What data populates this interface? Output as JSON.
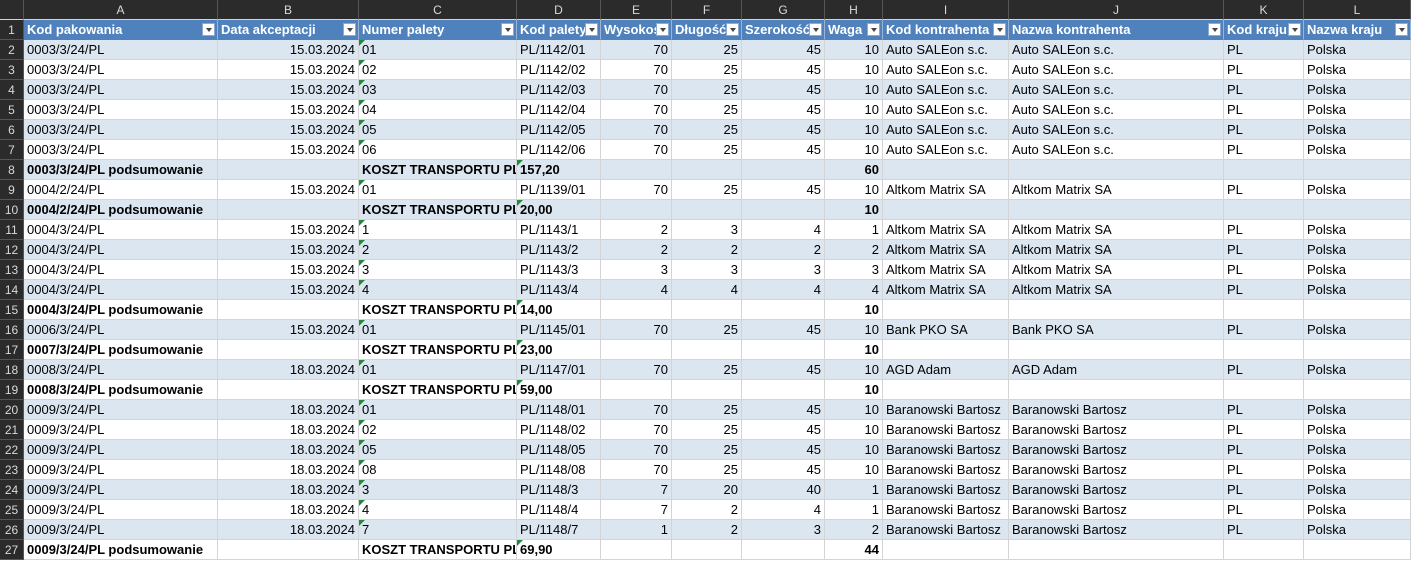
{
  "col_letters": [
    "A",
    "B",
    "C",
    "D",
    "E",
    "F",
    "G",
    "H",
    "I",
    "J",
    "K",
    "L"
  ],
  "headers": [
    "Kod pakowania",
    "Data akceptacji",
    "Numer palety",
    "Kod palety",
    "Wysokość",
    "Długość",
    "Szerokość",
    "Waga",
    "Kod kontrahenta",
    "Nazwa kontrahenta",
    "Kod kraju",
    "Nazwa kraju"
  ],
  "rows": [
    {
      "n": "2",
      "style": "alt",
      "sum": false,
      "cells": [
        "0003/3/24/PL",
        "15.03.2024",
        "01",
        "PL/1142/01",
        "70",
        "25",
        "45",
        "10",
        "Auto SALEon s.c.",
        "Auto SALEon s.c.",
        "PL",
        "Polska"
      ]
    },
    {
      "n": "3",
      "style": "white",
      "sum": false,
      "cells": [
        "0003/3/24/PL",
        "15.03.2024",
        "02",
        "PL/1142/02",
        "70",
        "25",
        "45",
        "10",
        "Auto SALEon s.c.",
        "Auto SALEon s.c.",
        "PL",
        "Polska"
      ]
    },
    {
      "n": "4",
      "style": "alt",
      "sum": false,
      "cells": [
        "0003/3/24/PL",
        "15.03.2024",
        "03",
        "PL/1142/03",
        "70",
        "25",
        "45",
        "10",
        "Auto SALEon s.c.",
        "Auto SALEon s.c.",
        "PL",
        "Polska"
      ]
    },
    {
      "n": "5",
      "style": "white",
      "sum": false,
      "cells": [
        "0003/3/24/PL",
        "15.03.2024",
        "04",
        "PL/1142/04",
        "70",
        "25",
        "45",
        "10",
        "Auto SALEon s.c.",
        "Auto SALEon s.c.",
        "PL",
        "Polska"
      ]
    },
    {
      "n": "6",
      "style": "alt",
      "sum": false,
      "cells": [
        "0003/3/24/PL",
        "15.03.2024",
        "05",
        "PL/1142/05",
        "70",
        "25",
        "45",
        "10",
        "Auto SALEon s.c.",
        "Auto SALEon s.c.",
        "PL",
        "Polska"
      ]
    },
    {
      "n": "7",
      "style": "white",
      "sum": false,
      "cells": [
        "0003/3/24/PL",
        "15.03.2024",
        "06",
        "PL/1142/06",
        "70",
        "25",
        "45",
        "10",
        "Auto SALEon s.c.",
        "Auto SALEon s.c.",
        "PL",
        "Polska"
      ]
    },
    {
      "n": "8",
      "style": "alt",
      "sum": true,
      "cells": [
        "0003/3/24/PL podsumowanie",
        "",
        "KOSZT TRANSPORTU PLN",
        "157,20",
        "",
        "",
        "",
        "60",
        "",
        "",
        "",
        ""
      ]
    },
    {
      "n": "9",
      "style": "white",
      "sum": false,
      "cells": [
        "0004/2/24/PL",
        "15.03.2024",
        "01",
        "PL/1139/01",
        "70",
        "25",
        "45",
        "10",
        "Altkom Matrix SA",
        "Altkom Matrix SA",
        "PL",
        "Polska"
      ]
    },
    {
      "n": "10",
      "style": "alt",
      "sum": true,
      "cells": [
        "0004/2/24/PL podsumowanie",
        "",
        "KOSZT TRANSPORTU PLN",
        "20,00",
        "",
        "",
        "",
        "10",
        "",
        "",
        "",
        ""
      ]
    },
    {
      "n": "11",
      "style": "white",
      "sum": false,
      "cells": [
        "0004/3/24/PL",
        "15.03.2024",
        "1",
        "PL/1143/1",
        "2",
        "3",
        "4",
        "1",
        "Altkom Matrix SA",
        "Altkom Matrix SA",
        "PL",
        "Polska"
      ]
    },
    {
      "n": "12",
      "style": "alt",
      "sum": false,
      "cells": [
        "0004/3/24/PL",
        "15.03.2024",
        "2",
        "PL/1143/2",
        "2",
        "2",
        "2",
        "2",
        "Altkom Matrix SA",
        "Altkom Matrix SA",
        "PL",
        "Polska"
      ]
    },
    {
      "n": "13",
      "style": "white",
      "sum": false,
      "cells": [
        "0004/3/24/PL",
        "15.03.2024",
        "3",
        "PL/1143/3",
        "3",
        "3",
        "3",
        "3",
        "Altkom Matrix SA",
        "Altkom Matrix SA",
        "PL",
        "Polska"
      ]
    },
    {
      "n": "14",
      "style": "alt",
      "sum": false,
      "cells": [
        "0004/3/24/PL",
        "15.03.2024",
        "4",
        "PL/1143/4",
        "4",
        "4",
        "4",
        "4",
        "Altkom Matrix SA",
        "Altkom Matrix SA",
        "PL",
        "Polska"
      ]
    },
    {
      "n": "15",
      "style": "white",
      "sum": true,
      "cells": [
        "0004/3/24/PL podsumowanie",
        "",
        "KOSZT TRANSPORTU PLN",
        "14,00",
        "",
        "",
        "",
        "10",
        "",
        "",
        "",
        ""
      ]
    },
    {
      "n": "16",
      "style": "alt",
      "sum": false,
      "cells": [
        "0006/3/24/PL",
        "15.03.2024",
        "01",
        "PL/1145/01",
        "70",
        "25",
        "45",
        "10",
        "Bank PKO SA",
        "Bank PKO SA",
        "PL",
        "Polska"
      ]
    },
    {
      "n": "17",
      "style": "white",
      "sum": true,
      "cells": [
        "0007/3/24/PL podsumowanie",
        "",
        "KOSZT TRANSPORTU PLN",
        "23,00",
        "",
        "",
        "",
        "10",
        "",
        "",
        "",
        ""
      ]
    },
    {
      "n": "18",
      "style": "alt",
      "sum": false,
      "cells": [
        "0008/3/24/PL",
        "18.03.2024",
        "01",
        "PL/1147/01",
        "70",
        "25",
        "45",
        "10",
        "AGD Adam",
        "AGD Adam",
        "PL",
        "Polska"
      ]
    },
    {
      "n": "19",
      "style": "white",
      "sum": true,
      "cells": [
        "0008/3/24/PL podsumowanie",
        "",
        "KOSZT TRANSPORTU PLN",
        "59,00",
        "",
        "",
        "",
        "10",
        "",
        "",
        "",
        ""
      ]
    },
    {
      "n": "20",
      "style": "alt",
      "sum": false,
      "cells": [
        "0009/3/24/PL",
        "18.03.2024",
        "01",
        "PL/1148/01",
        "70",
        "25",
        "45",
        "10",
        "Baranowski Bartosz",
        "Baranowski Bartosz",
        "PL",
        "Polska"
      ]
    },
    {
      "n": "21",
      "style": "white",
      "sum": false,
      "cells": [
        "0009/3/24/PL",
        "18.03.2024",
        "02",
        "PL/1148/02",
        "70",
        "25",
        "45",
        "10",
        "Baranowski Bartosz",
        "Baranowski Bartosz",
        "PL",
        "Polska"
      ]
    },
    {
      "n": "22",
      "style": "alt",
      "sum": false,
      "cells": [
        "0009/3/24/PL",
        "18.03.2024",
        "05",
        "PL/1148/05",
        "70",
        "25",
        "45",
        "10",
        "Baranowski Bartosz",
        "Baranowski Bartosz",
        "PL",
        "Polska"
      ]
    },
    {
      "n": "23",
      "style": "white",
      "sum": false,
      "cells": [
        "0009/3/24/PL",
        "18.03.2024",
        "08",
        "PL/1148/08",
        "70",
        "25",
        "45",
        "10",
        "Baranowski Bartosz",
        "Baranowski Bartosz",
        "PL",
        "Polska"
      ]
    },
    {
      "n": "24",
      "style": "alt",
      "sum": false,
      "cells": [
        "0009/3/24/PL",
        "18.03.2024",
        "3",
        "PL/1148/3",
        "7",
        "20",
        "40",
        "1",
        "Baranowski Bartosz",
        "Baranowski Bartosz",
        "PL",
        "Polska"
      ]
    },
    {
      "n": "25",
      "style": "white",
      "sum": false,
      "cells": [
        "0009/3/24/PL",
        "18.03.2024",
        "4",
        "PL/1148/4",
        "7",
        "2",
        "4",
        "1",
        "Baranowski Bartosz",
        "Baranowski Bartosz",
        "PL",
        "Polska"
      ]
    },
    {
      "n": "26",
      "style": "alt",
      "sum": false,
      "cells": [
        "0009/3/24/PL",
        "18.03.2024",
        "7",
        "PL/1148/7",
        "1",
        "2",
        "3",
        "2",
        "Baranowski Bartosz",
        "Baranowski Bartosz",
        "PL",
        "Polska"
      ]
    },
    {
      "n": "27",
      "style": "white",
      "sum": true,
      "cells": [
        "0009/3/24/PL podsumowanie",
        "",
        "KOSZT TRANSPORTU PLN",
        "69,90",
        "",
        "",
        "",
        "44",
        "",
        "",
        "",
        ""
      ]
    }
  ],
  "header_row_number": "1",
  "colors": {
    "header_bg": "#4f81bd",
    "band": "#dce6f1",
    "chrome": "#2b2b2b",
    "comment_marker": "#1e8a3a"
  }
}
